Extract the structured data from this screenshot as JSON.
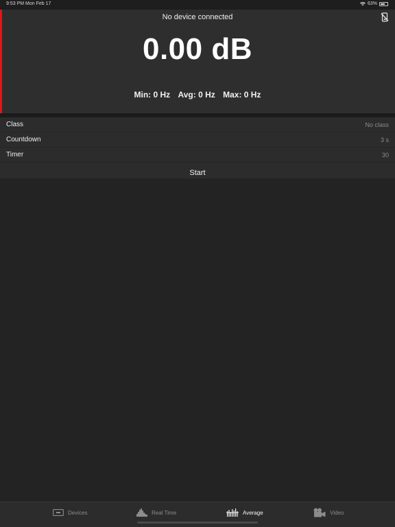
{
  "status_bar": {
    "time": "9:53 PM   Mon Feb 17",
    "battery": "63%",
    "battery_level": 0.63
  },
  "header": {
    "device_status": "No device connected",
    "db_value": "0.00 dB",
    "stats": {
      "min": "Min: 0 Hz",
      "avg": "Avg: 0 Hz",
      "max": "Max: 0 Hz"
    },
    "icons": {
      "no_device": "phone-disconnected-icon"
    }
  },
  "colors": {
    "accent": "#e0161b",
    "background": "#232323",
    "panel": "#2e2e2e",
    "inactive_text": "#8c8c8c",
    "active_text": "#f5f5f5"
  },
  "settings": {
    "rows": [
      {
        "label": "Class",
        "value": "No class"
      },
      {
        "label": "Countdown",
        "value": "3 s"
      },
      {
        "label": "Timer",
        "value": "30"
      }
    ],
    "start_label": "Start"
  },
  "tabs": [
    {
      "label": "Devices",
      "icon": "devices-icon",
      "active": false
    },
    {
      "label": "Real Time",
      "icon": "real-time-chart-icon",
      "active": false
    },
    {
      "label": "Average",
      "icon": "average-bars-icon",
      "active": true
    },
    {
      "label": "Video",
      "icon": "video-camera-icon",
      "active": false
    }
  ]
}
